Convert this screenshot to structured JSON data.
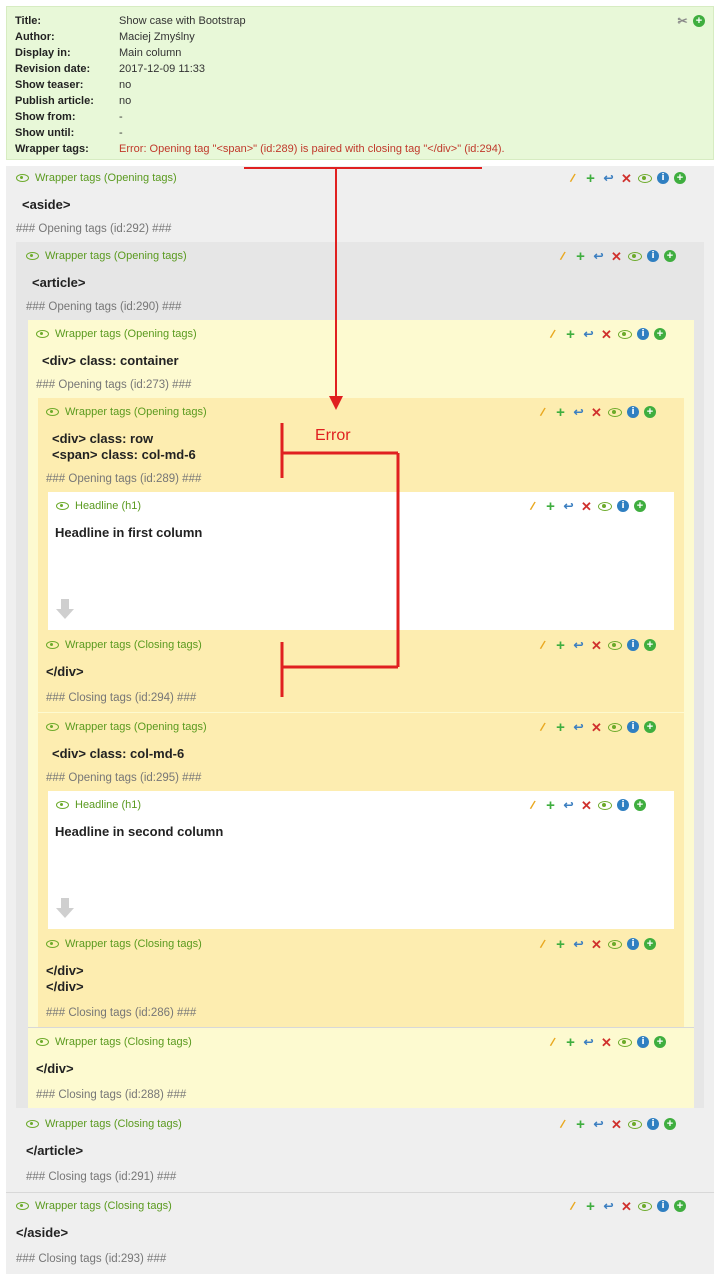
{
  "info": {
    "rows": [
      {
        "label": "Title:",
        "value": "Show case with Bootstrap"
      },
      {
        "label": "Author:",
        "value": "Maciej Zmyślny"
      },
      {
        "label": "Display in:",
        "value": "Main column"
      },
      {
        "label": "Revision date:",
        "value": "2017-12-09 11:33"
      },
      {
        "label": "Show teaser:",
        "value": "no"
      },
      {
        "label": "Publish article:",
        "value": "no"
      },
      {
        "label": "Show from:",
        "value": "-"
      },
      {
        "label": "Show until:",
        "value": "-"
      },
      {
        "label": "Wrapper tags:",
        "value": "Error: Opening tag \"<span>\" (id:289) is paired with closing tag \"</div>\" (id:294)."
      }
    ]
  },
  "labels": {
    "wrapper_open": "Wrapper tags (Opening tags)",
    "wrapper_close": "Wrapper tags (Closing tags)",
    "headline": "Headline (h1)"
  },
  "blocks": {
    "aside_open_tag": "<aside>",
    "aside_open_comment": "### Opening tags (id:292) ###",
    "article_open_tag": "<article>",
    "article_open_comment": "### Opening tags (id:290) ###",
    "container_open_tag": "<div> class: container",
    "container_open_comment": "### Opening tags (id:273) ###",
    "row_open_tag": "<div> class: row\n<span> class: col-md-6",
    "row_open_comment": "### Opening tags (id:289) ###",
    "headline1": "Headline in first column",
    "close1_tag": "</div>",
    "close1_comment": "### Closing tags (id:294) ###",
    "col2_open_tag": "<div> class: col-md-6",
    "col2_open_comment": "### Opening tags (id:295) ###",
    "headline2": "Headline in second column",
    "close2_tag": "</div>\n</div>",
    "close2_comment": "### Closing tags (id:286) ###",
    "container_close_tag": "</div>",
    "container_close_comment": "### Closing tags (id:288) ###",
    "article_close_tag": "</article>",
    "article_close_comment": "### Closing tags (id:291) ###",
    "aside_close_tag": "</aside>",
    "aside_close_comment": "### Closing tags (id:293) ###"
  },
  "annotation": {
    "error_label": "Error"
  },
  "colors": {
    "accent_green": "#5a9a1f",
    "error_red": "#e02020"
  }
}
